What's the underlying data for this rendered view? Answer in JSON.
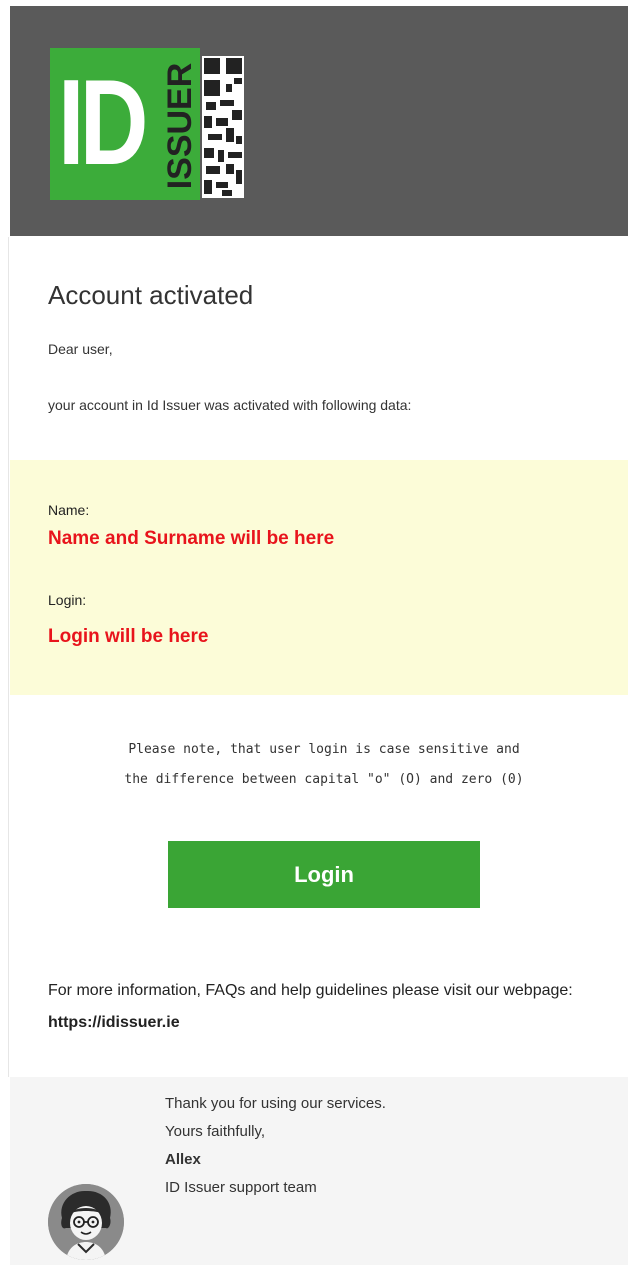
{
  "logo": {
    "id_text": "ID",
    "issuer_text": "ISSUER"
  },
  "email": {
    "title": "Account activated",
    "greeting": "Dear user,",
    "intro": "your account in Id Issuer was activated with following data:"
  },
  "account": {
    "name_label": "Name:",
    "name_value": "Name and Surname will be here",
    "login_label": "Login:",
    "login_value": "Login will be here"
  },
  "note": {
    "line1": "Please note, that user login is case sensitive and",
    "line2": "the difference between capital \"o\" (O) and zero (0)"
  },
  "login_button": {
    "label": "Login"
  },
  "more_info": {
    "text": "For more information, FAQs and help guidelines please visit our webpage: ",
    "link": "https://idissuer.ie"
  },
  "footer": {
    "thanks": "Thank you for using our services.",
    "closing": "Yours faithfully,",
    "signer": "Allex",
    "team": "ID Issuer support team"
  },
  "colors": {
    "header_bg": "#5a5a5a",
    "brand_green": "#3cac3a",
    "button_green": "#3aa535",
    "highlight_red": "#e8141c",
    "info_bg": "#fcfcd8",
    "footer_bg": "#f5f5f5"
  }
}
